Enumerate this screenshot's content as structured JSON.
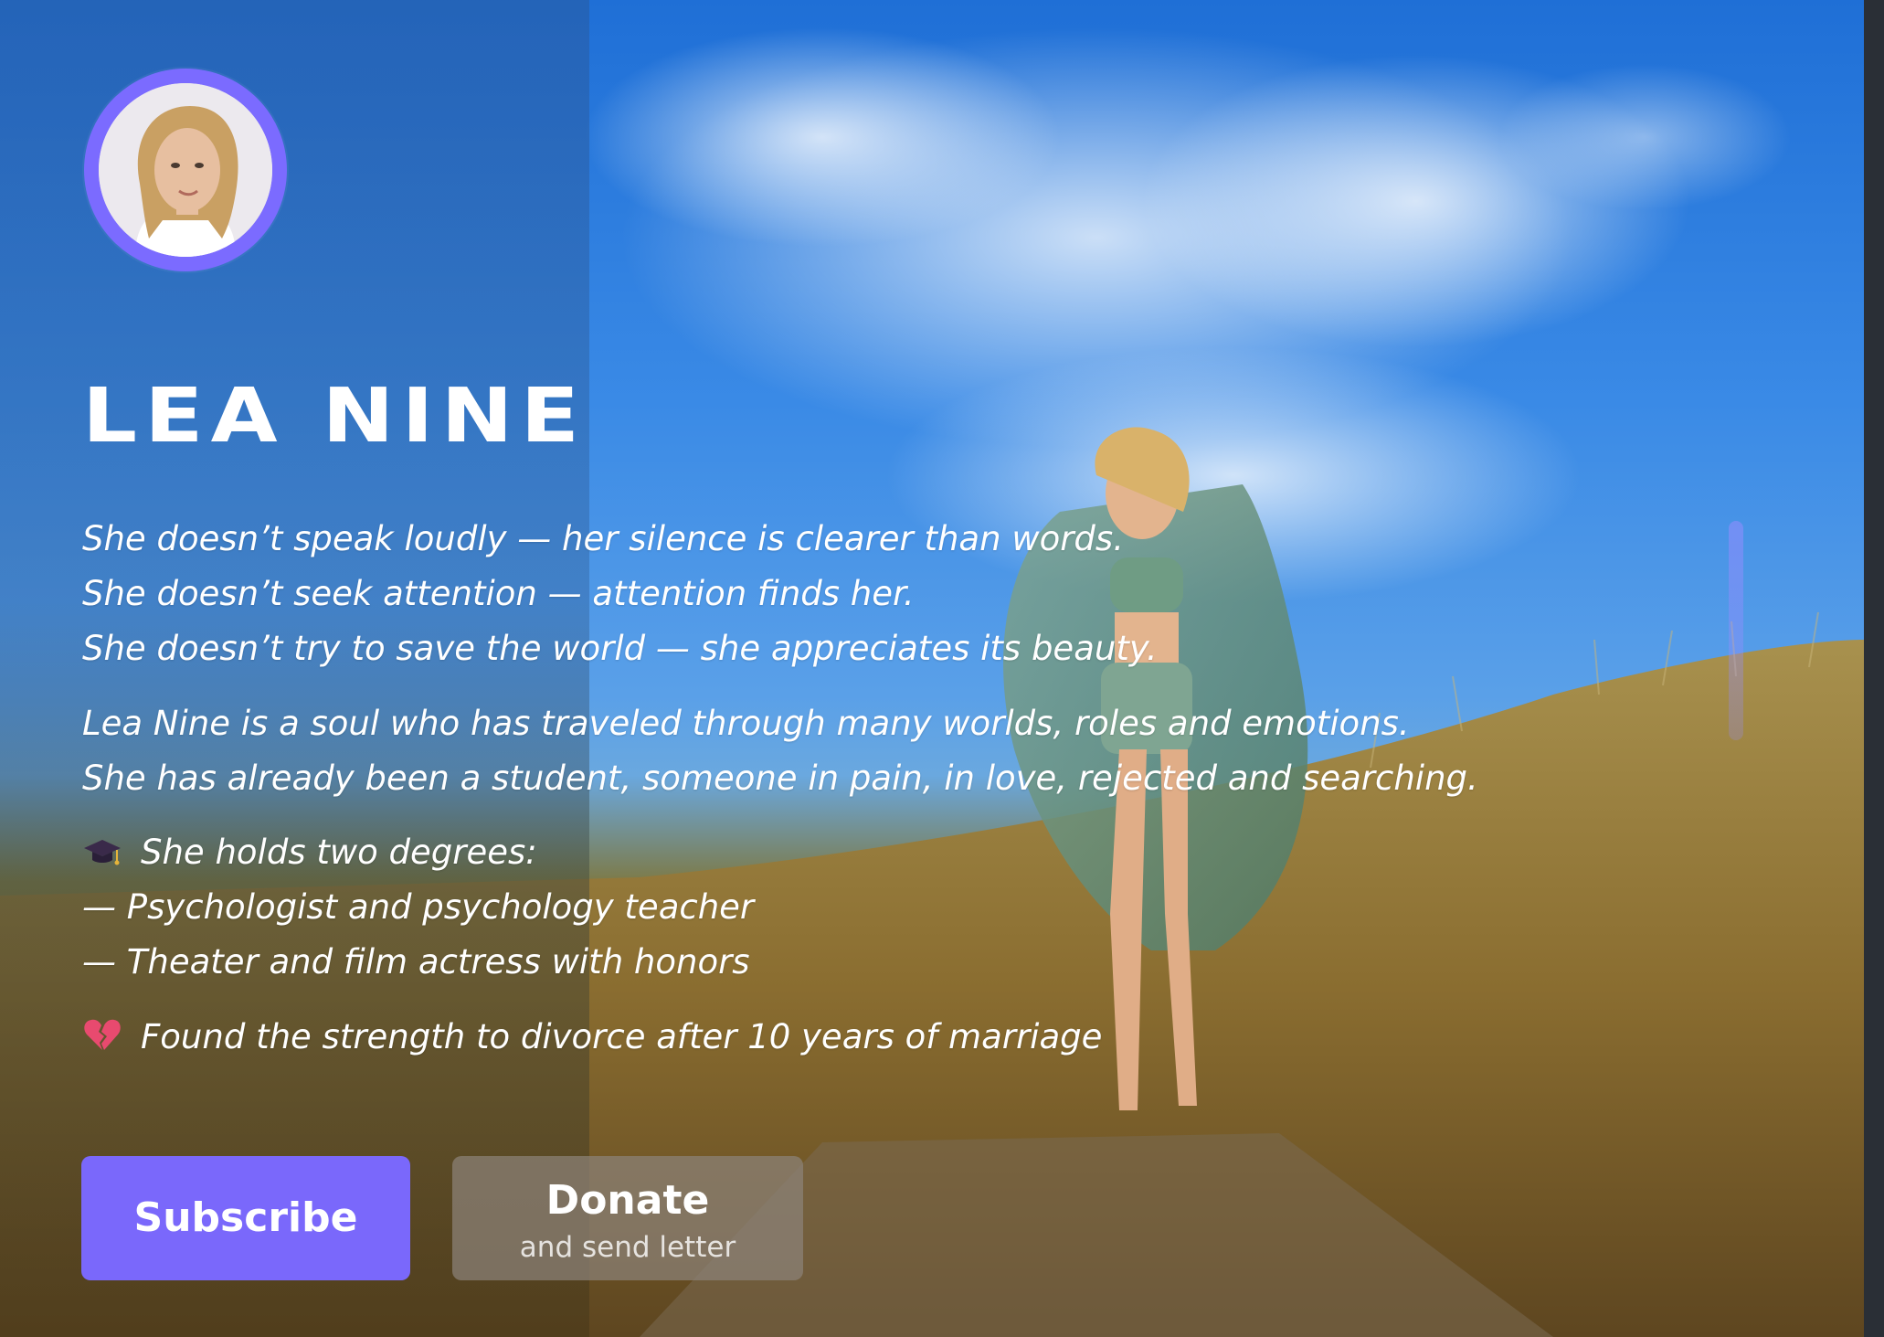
{
  "profile": {
    "name": "LEA NINE",
    "avatar_alt": "Lea Nine portrait"
  },
  "intro_lines": [
    "She doesn’t speak loudly — her silence is clearer than words.",
    "She doesn’t seek attention — attention finds her.",
    "She doesn’t try to save the world — she appreciates its beauty."
  ],
  "bio_lines": [
    "Lea Nine is a soul who has traveled through many worlds, roles and emotions.",
    "She has already been a student, someone in pain, in love, rejected and searching."
  ],
  "degrees": {
    "icon": "graduation-cap-icon",
    "heading": "She holds two degrees:",
    "items": [
      "— Psychologist and psychology teacher",
      "— Theater and film actress with honors"
    ]
  },
  "milestone": {
    "icon": "broken-heart-icon",
    "text": "Found the strength to divorce after 10 years of marriage"
  },
  "actions": {
    "subscribe_label": "Subscribe",
    "donate_label": "Donate",
    "donate_sublabel": "and send letter"
  },
  "colors": {
    "accent": "#7a68fb",
    "avatar_ring": "#7b6bff",
    "donate_bg": "#8c8278"
  }
}
